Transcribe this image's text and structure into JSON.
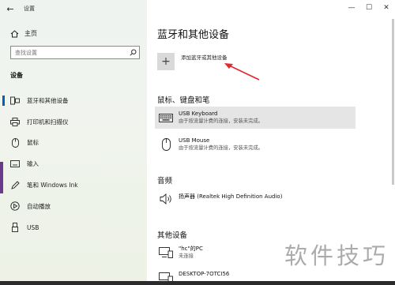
{
  "app": {
    "title": "设置",
    "back_icon": "back-arrow-icon"
  },
  "sidebar": {
    "home_label": "主页",
    "search_placeholder": "查找设置",
    "section_title": "设备",
    "items": [
      {
        "label": "蓝牙和其他设备",
        "icon": "bluetooth-devices-icon",
        "active": true
      },
      {
        "label": "打印机和扫描仪",
        "icon": "printer-icon",
        "active": false
      },
      {
        "label": "鼠标",
        "icon": "mouse-icon",
        "active": false
      },
      {
        "label": "输入",
        "icon": "keyboard-icon",
        "active": false
      },
      {
        "label": "笔和 Windows Ink",
        "icon": "pen-icon",
        "active": false
      },
      {
        "label": "自动播放",
        "icon": "autoplay-icon",
        "active": false
      },
      {
        "label": "USB",
        "icon": "usb-icon",
        "active": false
      }
    ]
  },
  "window_controls": {
    "minimize": "—",
    "maximize": "☐",
    "close": "✕"
  },
  "main": {
    "title": "蓝牙和其他设备",
    "add_device_label": "添加蓝牙或其他设备",
    "groups": {
      "mouse_keyboard_pen": {
        "title": "鼠标、键盘和笔",
        "devices": [
          {
            "name": "USB Keyboard",
            "status": "由于按流量计费的连接，安装未完成。",
            "icon": "keyboard-device-icon"
          },
          {
            "name": "USB Mouse",
            "status": "由于按流量计费的连接，安装未完成。",
            "icon": "mouse-device-icon"
          }
        ]
      },
      "audio": {
        "title": "音频",
        "devices": [
          {
            "name": "扬声器 (Realtek High Definition Audio)",
            "icon": "speaker-icon"
          }
        ]
      },
      "other": {
        "title": "其他设备",
        "devices": [
          {
            "name": "\"hc\"的PC",
            "status": "未连接",
            "icon": "pc-icon"
          },
          {
            "name": "DESKTOP-7OTCI56",
            "icon": "pc-icon"
          }
        ]
      }
    }
  },
  "watermark": "软件技巧",
  "colors": {
    "accent": "#0063b1",
    "arrow": "#e0282e",
    "selected_bg": "#e5e5e5"
  }
}
